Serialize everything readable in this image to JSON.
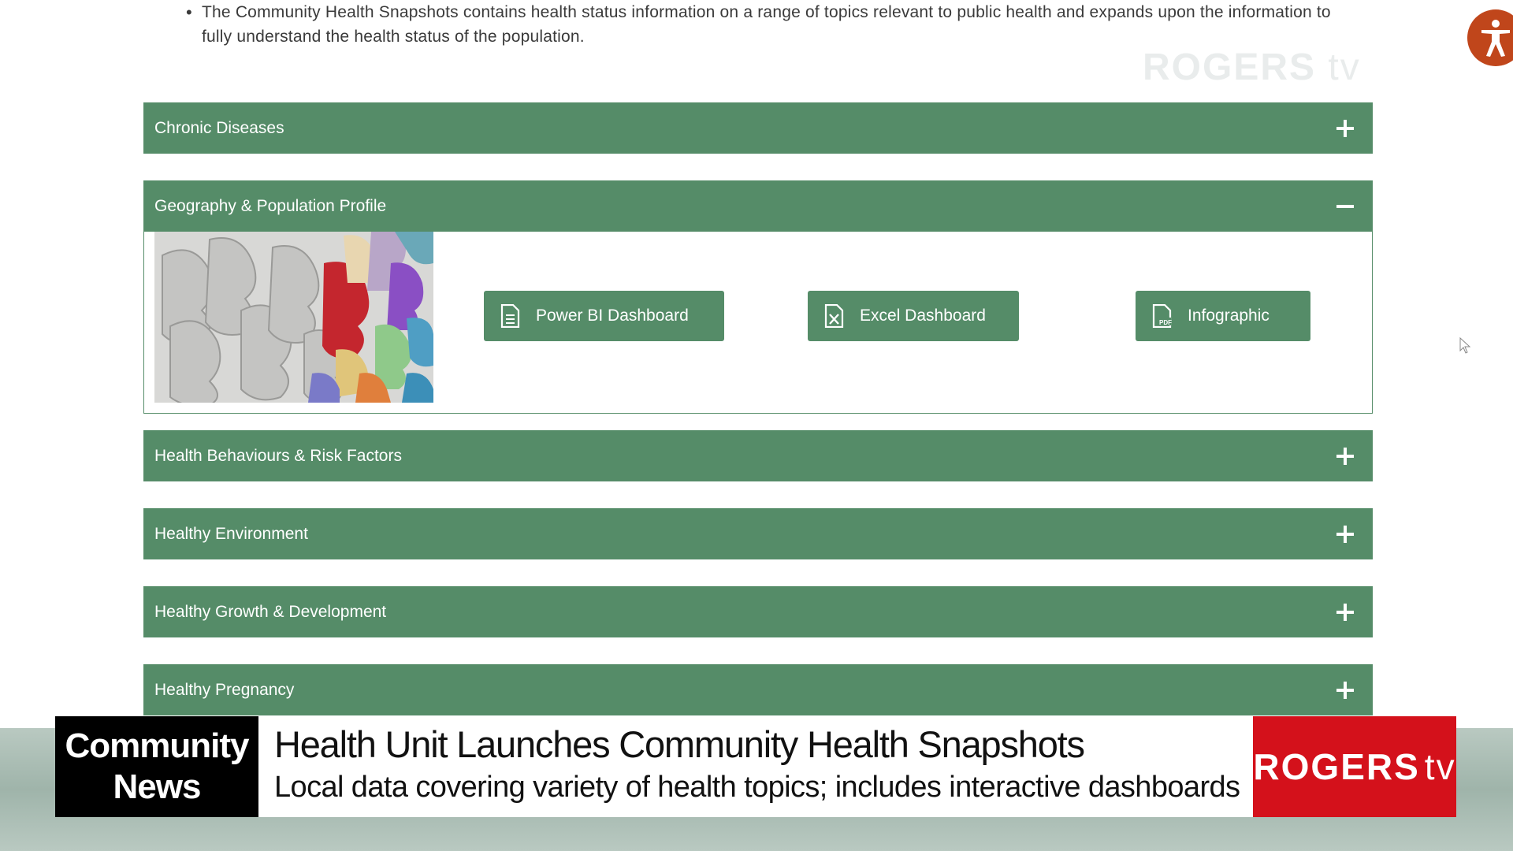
{
  "intro": {
    "text": "The Community Health Snapshots contains health status information on a range of topics relevant to public health and expands upon the information to fully understand the health status of the population."
  },
  "watermark": {
    "brand": "ROGERS",
    "tv": "tv"
  },
  "accordion": [
    {
      "title": "Chronic Diseases",
      "state": "collapsed"
    },
    {
      "title": "Geography & Population Profile",
      "state": "expanded"
    },
    {
      "title": "Health Behaviours & Risk Factors",
      "state": "collapsed"
    },
    {
      "title": "Healthy Environment",
      "state": "collapsed"
    },
    {
      "title": "Healthy Growth & Development",
      "state": "collapsed"
    },
    {
      "title": "Healthy Pregnancy",
      "state": "collapsed"
    }
  ],
  "expanded_panel": {
    "buttons": [
      {
        "label": "Power BI Dashboard",
        "icon": "document-icon"
      },
      {
        "label": "Excel Dashboard",
        "icon": "excel-file-icon"
      },
      {
        "label": "Infographic",
        "icon": "pdf-file-icon"
      }
    ]
  },
  "lower_third": {
    "left_line1": "Community",
    "left_line2": "News",
    "headline": "Health Unit Launches Community Health Snapshots",
    "subheadline": "Local data covering variety of health topics; includes interactive dashboards",
    "brand": "ROGERS",
    "brand_tv": "tv"
  },
  "colors": {
    "accordion_green": "#558c68",
    "accessibility_orange": "#c0461b",
    "rogers_red": "#d4111b"
  }
}
